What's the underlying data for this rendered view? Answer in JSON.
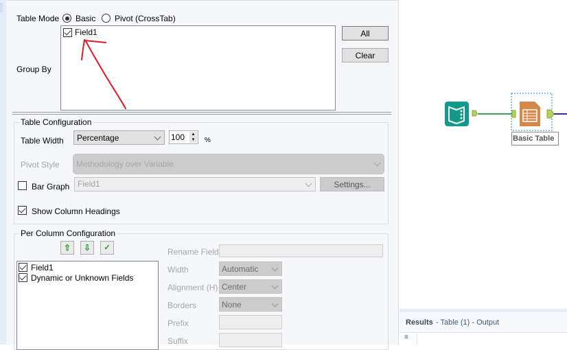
{
  "table_mode": {
    "label": "Table Mode",
    "options": [
      "Basic",
      "Pivot (CrossTab)"
    ],
    "selected": "Basic"
  },
  "group_by": {
    "label": "Group By",
    "items": [
      {
        "label": "Field1",
        "checked": true
      }
    ],
    "all_label": "All",
    "clear_label": "Clear"
  },
  "table_config": {
    "title": "Table Configuration",
    "table_width_label": "Table Width",
    "table_width_value": "Percentage",
    "width_number": "100",
    "percent_sign": "%",
    "pivot_style_label": "Pivot Style",
    "pivot_style_value": "Methodology over Variable",
    "bar_graph_label": "Bar Graph",
    "bar_graph_checked": false,
    "bar_graph_field": "Field1",
    "settings_label": "Settings...",
    "show_headings_label": "Show Column Headings",
    "show_headings_checked": true
  },
  "per_column": {
    "title": "Per Column Configuration",
    "icons": [
      "arrow-up-icon",
      "arrow-down-icon",
      "check-icon"
    ],
    "fields": [
      {
        "label": "Field1",
        "checked": true
      },
      {
        "label": "Dynamic or Unknown Fields",
        "checked": true
      }
    ],
    "rename_label": "Rename Field",
    "width_label": "Width",
    "width_value": "Automatic",
    "alignment_label": "Alignment (H)",
    "alignment_value": "Center",
    "borders_label": "Borders",
    "borders_value": "None",
    "prefix_label": "Prefix",
    "suffix_label": "Suffix"
  },
  "canvas": {
    "tool_label": "Basic Table",
    "colors": {
      "input_tool": "#119a8a",
      "table_tool": "#d4894a",
      "connector": "#3ba55c",
      "output_line": "#2b2bd6"
    }
  },
  "results": {
    "title": "Results",
    "subtitle": "- Table (1) - Output"
  }
}
